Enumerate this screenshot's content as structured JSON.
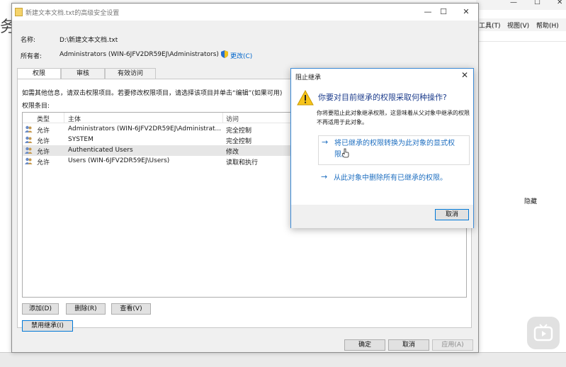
{
  "background": {
    "left_char": "务",
    "menu": [
      "工具(T)",
      "视图(V)",
      "帮助(H)"
    ],
    "window_controls": [
      "—",
      "☐",
      "✕"
    ],
    "right_panel_text": "隐藏"
  },
  "main_window": {
    "title": "新建文本文档.txt的高级安全设置",
    "name_label": "名称:",
    "name_value": "D:\\新建文本文档.txt",
    "owner_label": "所有者:",
    "owner_value": "Administrators (WIN-6JFV2DR59EJ\\Administrators)",
    "change_link": "更改(C)",
    "tabs": [
      "权限",
      "审核",
      "有效访问"
    ],
    "hint": "如需其他信息，请双击权限项目。若要修改权限项目，请选择该项目并单击“编辑”(如果可用)",
    "entries_label": "权限条目:",
    "columns": [
      "类型",
      "主体",
      "访问"
    ],
    "rows": [
      {
        "type": "允许",
        "principal": "Administrators (WIN-6JFV2DR59EJ\\Administrat...",
        "access": "完全控制"
      },
      {
        "type": "允许",
        "principal": "SYSTEM",
        "access": "完全控制"
      },
      {
        "type": "允许",
        "principal": "Authenticated Users",
        "access": "修改"
      },
      {
        "type": "允许",
        "principal": "Users (WIN-6JFV2DR59EJ\\Users)",
        "access": "读取和执行"
      }
    ],
    "add_button": "添加(D)",
    "remove_button": "删除(R)",
    "view_button": "查看(V)",
    "disable_inheritance_button": "禁用继承(I)",
    "ok_button": "确定",
    "cancel_button": "取消",
    "apply_button": "应用(A)"
  },
  "block_dialog": {
    "title": "阻止继承",
    "question": "你要对目前继承的权限采取何种操作?",
    "description": "你将要阻止此对象继承权限，这意味着从父对象中继承的权限不再适用于此对象。",
    "option1": "将已继承的权限转换为此对象的显式权限。",
    "option2": "从此对象中删除所有已继承的权限。",
    "cancel": "取消"
  }
}
